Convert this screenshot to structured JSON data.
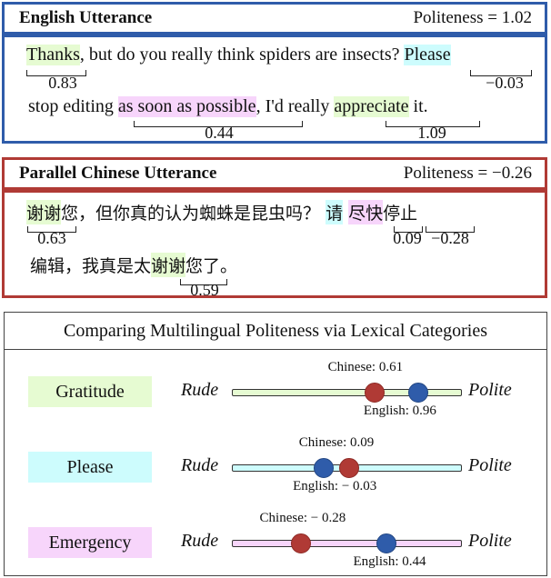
{
  "english": {
    "title": "English Utterance",
    "politeness": "Politeness = 1.02",
    "line1": {
      "w1": "Thanks",
      "t1": ", but do you really think spiders are insects? ",
      "w2": "Please"
    },
    "line2": {
      "t0": "stop editing ",
      "w1": "as soon as possible",
      "t1": ", I'd really ",
      "w2": "appreciate",
      "t2": " it."
    },
    "values": {
      "thanks": "0.83",
      "please": "−0.03",
      "asap": "0.44",
      "appreciate": "1.09"
    }
  },
  "chinese": {
    "title": "Parallel Chinese Utterance",
    "politeness": "Politeness = −0.26",
    "line1": {
      "w1": "谢谢",
      "t1": "您，但你真的认为蜘蛛是昆虫吗？ ",
      "w2": "请",
      "sp": " ",
      "w3": "尽快",
      "t3": "停止"
    },
    "line2": {
      "t0": "编辑，我真是太",
      "w1": "谢谢",
      "t1": "您了。"
    },
    "values": {
      "xiexie1": "0.63",
      "qing": "0.09",
      "jinkuai": "−0.28",
      "xiexie2": "0.59"
    }
  },
  "comparison": {
    "title": "Comparing Multilingual Politeness via Lexical Categories",
    "rude_label": "Rude",
    "polite_label": "Polite",
    "colors": {
      "chinese": "#b03a35",
      "english": "#2f5caa",
      "gratitude": "#e6fbd2",
      "please": "#cdfcfd",
      "emergency": "#f7d5fb"
    },
    "categories": [
      {
        "name": "Gratitude",
        "chinese_label": "Chinese: 0.61",
        "english_label": "English: 0.96",
        "chinese": 0.61,
        "english": 0.96,
        "chinese_pos": 0.62,
        "english_pos": 0.81
      },
      {
        "name": "Please",
        "chinese_label": "Chinese: 0.09",
        "english_label": "English: − 0.03",
        "chinese": 0.09,
        "english": -0.03,
        "chinese_pos": 0.51,
        "english_pos": 0.4
      },
      {
        "name": "Emergency",
        "chinese_label": "Chinese: − 0.28",
        "english_label": "English: 0.44",
        "chinese": -0.28,
        "english": 0.44,
        "chinese_pos": 0.3,
        "english_pos": 0.67
      }
    ]
  }
}
